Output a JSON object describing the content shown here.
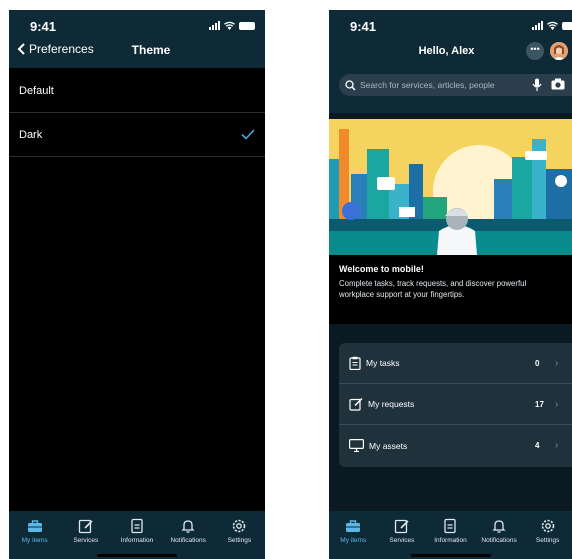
{
  "left": {
    "status_time": "9:41",
    "back_label": "Preferences",
    "title": "Theme",
    "options": [
      {
        "label": "Default",
        "selected": false
      },
      {
        "label": "Dark",
        "selected": true
      }
    ]
  },
  "right": {
    "status_time": "9:41",
    "greeting": "Hello, Alex",
    "more_icon": "ellipsis-icon",
    "search_placeholder": "Search for services, articles, people",
    "welcome_title": "Welcome to mobile!",
    "welcome_line1": "Complete tasks, track requests, and discover powerful",
    "welcome_line2": "workplace support at your fingertips.",
    "summary": [
      {
        "label": "My tasks",
        "count": "0",
        "icon": "clipboard-icon"
      },
      {
        "label": "My requests",
        "count": "17",
        "icon": "edit-icon"
      },
      {
        "label": "My assets",
        "count": "4",
        "icon": "monitor-icon"
      }
    ]
  },
  "tabs": [
    {
      "label": "My items",
      "icon": "briefcase-icon",
      "active": true
    },
    {
      "label": "Services",
      "icon": "edit-icon",
      "active": false
    },
    {
      "label": "Information",
      "icon": "document-icon",
      "active": false
    },
    {
      "label": "Notifications",
      "icon": "bell-icon",
      "active": false
    },
    {
      "label": "Settings",
      "icon": "gear-icon",
      "active": false
    }
  ],
  "colors": {
    "accent": "#5bb8e8",
    "header": "#0f2a37",
    "background_dark": "#000000"
  }
}
